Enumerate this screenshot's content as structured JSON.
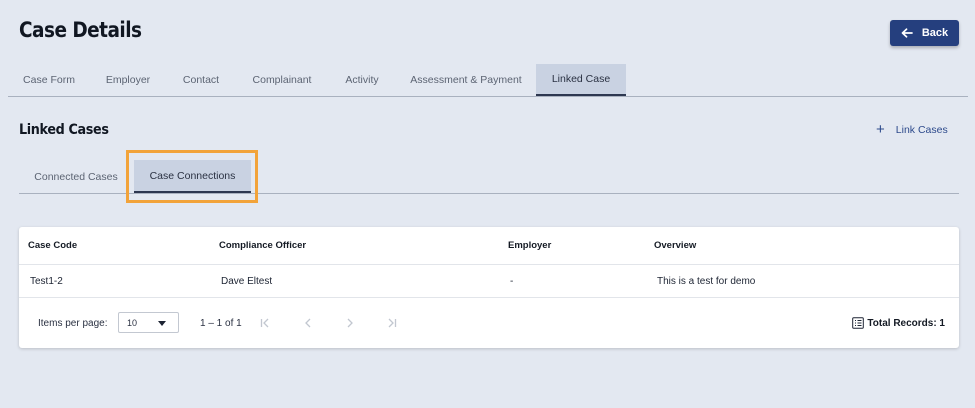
{
  "header": {
    "title": "Case Details",
    "back_label": "Back"
  },
  "main_tabs": [
    {
      "label": "Case Form"
    },
    {
      "label": "Employer"
    },
    {
      "label": "Contact"
    },
    {
      "label": "Complainant"
    },
    {
      "label": "Activity"
    },
    {
      "label": "Assessment & Payment"
    },
    {
      "label": "Linked Case",
      "active": true
    }
  ],
  "section": {
    "title": "Linked Cases",
    "link_cases_label": "Link Cases"
  },
  "sub_tabs": [
    {
      "label": "Connected Cases"
    },
    {
      "label": "Case Connections",
      "active": true
    }
  ],
  "table": {
    "columns": [
      "Case Code",
      "Compliance Officer",
      "Employer",
      "Overview"
    ],
    "rows": [
      [
        "Test1-2",
        "Dave Eltest",
        "-",
        "This is a test for demo"
      ]
    ]
  },
  "pager": {
    "items_per_page_label": "Items per page:",
    "items_per_page_value": "10",
    "range_text": "1 – 1 of 1",
    "total_records_label": "Total Records: 1"
  },
  "colors": {
    "background": "#e3e8f1",
    "primary": "#253f7e",
    "active_tab": "#c9d2e2",
    "highlight": "#f2a33a"
  },
  "icons": {
    "back": "arrow-left-icon",
    "link": "plus-icon",
    "first": "first-page-icon",
    "prev": "chevron-left-icon",
    "next": "chevron-right-icon",
    "last": "last-page-icon",
    "records": "list-icon"
  }
}
